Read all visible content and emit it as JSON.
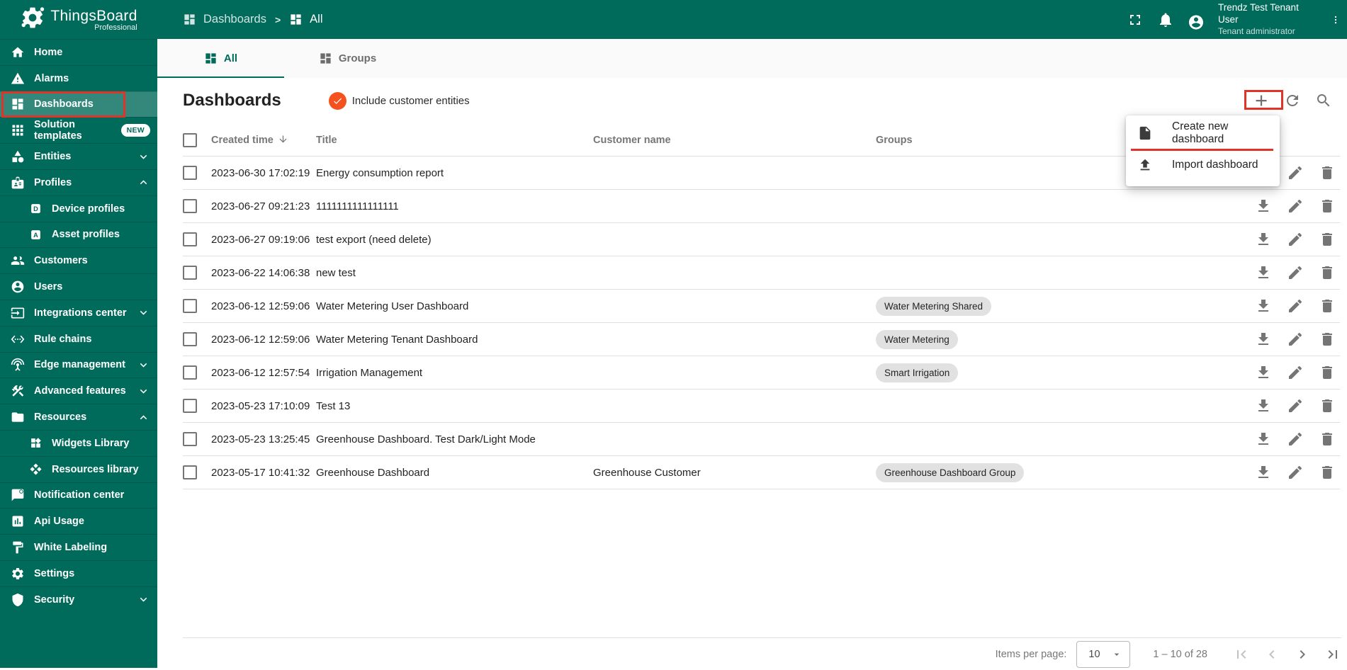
{
  "app": {
    "logo_title": "ThingsBoard",
    "logo_subtitle": "Professional"
  },
  "header": {
    "breadcrumb": {
      "parent": "Dashboards",
      "current": "All",
      "separator": ">"
    },
    "user": {
      "name": "Trendz Test Tenant User",
      "role": "Tenant administrator"
    }
  },
  "sidebar": {
    "items": [
      {
        "label": "Home",
        "icon": "home-icon"
      },
      {
        "label": "Alarms",
        "icon": "alarm-warning-icon"
      },
      {
        "label": "Dashboards",
        "icon": "dashboard-icon",
        "active": true
      },
      {
        "label": "Solution templates",
        "icon": "solution-templates-icon",
        "badge": "NEW"
      },
      {
        "label": "Entities",
        "icon": "entities-icon",
        "chevron": "down"
      },
      {
        "label": "Profiles",
        "icon": "profiles-icon",
        "chevron": "up"
      },
      {
        "label": "Device profiles",
        "icon": "device-profile-icon",
        "indent": true
      },
      {
        "label": "Asset profiles",
        "icon": "asset-profile-icon",
        "indent": true
      },
      {
        "label": "Customers",
        "icon": "customers-icon"
      },
      {
        "label": "Users",
        "icon": "users-icon"
      },
      {
        "label": "Integrations center",
        "icon": "integrations-icon",
        "chevron": "down"
      },
      {
        "label": "Rule chains",
        "icon": "rule-chains-icon"
      },
      {
        "label": "Edge management",
        "icon": "edge-management-icon",
        "chevron": "down"
      },
      {
        "label": "Advanced features",
        "icon": "advanced-features-icon",
        "chevron": "down"
      },
      {
        "label": "Resources",
        "icon": "resources-icon",
        "chevron": "up"
      },
      {
        "label": "Widgets Library",
        "icon": "widgets-library-icon",
        "indent": true
      },
      {
        "label": "Resources library",
        "icon": "resources-library-icon",
        "indent": true
      },
      {
        "label": "Notification center",
        "icon": "notification-center-icon"
      },
      {
        "label": "Api Usage",
        "icon": "api-usage-icon"
      },
      {
        "label": "White Labeling",
        "icon": "white-labeling-icon"
      },
      {
        "label": "Settings",
        "icon": "settings-gear-icon"
      },
      {
        "label": "Security",
        "icon": "security-shield-icon",
        "chevron": "down"
      }
    ]
  },
  "tabs": [
    {
      "label": "All",
      "active": true
    },
    {
      "label": "Groups",
      "active": false
    }
  ],
  "main": {
    "title": "Dashboards",
    "toggle_label": "Include customer entities",
    "toggle_on": true
  },
  "menu": {
    "items": [
      {
        "label": "Create new dashboard",
        "icon": "file-icon",
        "annotated": true
      },
      {
        "label": "Import dashboard",
        "icon": "upload-icon"
      }
    ]
  },
  "table": {
    "columns": {
      "created": "Created time",
      "title": "Title",
      "customer": "Customer name",
      "groups": "Groups"
    },
    "sorted_by": "Created time",
    "sort_direction": "desc",
    "rows": [
      {
        "created": "2023-06-30 17:02:19",
        "title": "Energy consumption report",
        "customer": "",
        "groups": []
      },
      {
        "created": "2023-06-27 09:21:23",
        "title": "1111111111111111",
        "customer": "",
        "groups": []
      },
      {
        "created": "2023-06-27 09:19:06",
        "title": "test export (need delete)",
        "customer": "",
        "groups": []
      },
      {
        "created": "2023-06-22 14:06:38",
        "title": "new test",
        "customer": "",
        "groups": []
      },
      {
        "created": "2023-06-12 12:59:06",
        "title": "Water Metering User Dashboard",
        "customer": "",
        "groups": [
          "Water Metering Shared"
        ]
      },
      {
        "created": "2023-06-12 12:59:06",
        "title": "Water Metering Tenant Dashboard",
        "customer": "",
        "groups": [
          "Water Metering"
        ]
      },
      {
        "created": "2023-06-12 12:57:54",
        "title": "Irrigation Management",
        "customer": "",
        "groups": [
          "Smart Irrigation"
        ]
      },
      {
        "created": "2023-05-23 17:10:09",
        "title": "Test 13",
        "customer": "",
        "groups": []
      },
      {
        "created": "2023-05-23 13:25:45",
        "title": "Greenhouse Dashboard. Test Dark/Light Mode",
        "customer": "",
        "groups": []
      },
      {
        "created": "2023-05-17 10:41:32",
        "title": "Greenhouse Dashboard",
        "customer": "Greenhouse Customer",
        "groups": [
          "Greenhouse Dashboard Group"
        ]
      }
    ]
  },
  "pagination": {
    "items_per_page_label": "Items per page:",
    "items_per_page": "10",
    "range": "1 – 10 of 28"
  },
  "colors": {
    "sidebar_teal": "#006b5b",
    "active_item_overlay": "rgba(255,255,255,0.2)",
    "toggle_orange": "#f4511e",
    "annotation_red": "#e23328",
    "chip_gray": "#e1e1e1",
    "icon_gray": "#757575"
  }
}
